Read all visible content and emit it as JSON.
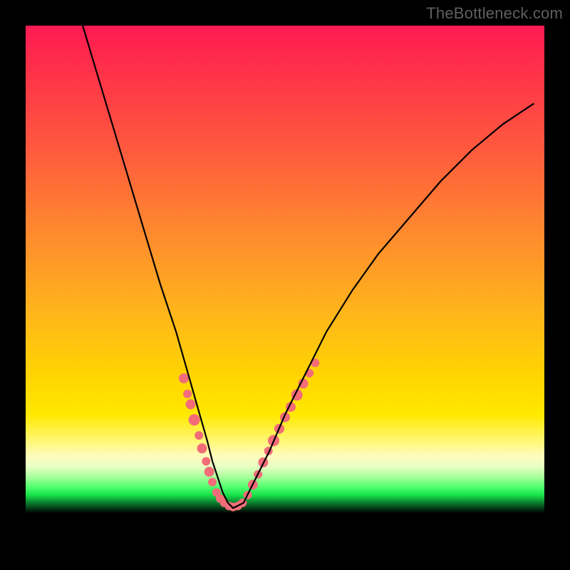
{
  "watermark": "TheBottleneck.com",
  "chart_data": {
    "type": "line",
    "title": "",
    "xlabel": "",
    "ylabel": "",
    "xlim": [
      0,
      100
    ],
    "ylim": [
      0,
      100
    ],
    "grid": false,
    "legend": false,
    "series": [
      {
        "name": "curve",
        "stroke": "#000000",
        "x": [
          11,
          14,
          17,
          20,
          23,
          26,
          29,
          31,
          33,
          35,
          36,
          37,
          38,
          39,
          40,
          42,
          44,
          47,
          50,
          54,
          58,
          63,
          68,
          74,
          80,
          86,
          92,
          98
        ],
        "y": [
          100,
          90,
          80,
          70,
          60,
          50,
          41,
          34,
          27,
          20,
          16,
          13,
          10,
          8,
          7,
          8,
          12,
          18,
          25,
          33,
          41,
          49,
          56,
          63,
          70,
          76,
          81,
          85
        ]
      }
    ],
    "markers": [
      {
        "name": "dots-left",
        "color": "#f26d78",
        "points": [
          {
            "x": 30.5,
            "y": 32,
            "r": 7
          },
          {
            "x": 31.2,
            "y": 29,
            "r": 6
          },
          {
            "x": 31.8,
            "y": 27,
            "r": 7
          },
          {
            "x": 32.5,
            "y": 24,
            "r": 8
          },
          {
            "x": 33.4,
            "y": 21,
            "r": 6
          },
          {
            "x": 34.0,
            "y": 18.5,
            "r": 7
          },
          {
            "x": 34.8,
            "y": 16,
            "r": 6
          },
          {
            "x": 35.4,
            "y": 14,
            "r": 7
          },
          {
            "x": 36.0,
            "y": 12,
            "r": 6
          },
          {
            "x": 36.8,
            "y": 10,
            "r": 6
          }
        ]
      },
      {
        "name": "dots-bottom",
        "color": "#f26d78",
        "points": [
          {
            "x": 37.5,
            "y": 8.8,
            "r": 6
          },
          {
            "x": 38.3,
            "y": 8.0,
            "r": 6
          },
          {
            "x": 39.2,
            "y": 7.4,
            "r": 6
          },
          {
            "x": 40.0,
            "y": 7.2,
            "r": 6
          },
          {
            "x": 40.9,
            "y": 7.4,
            "r": 6
          },
          {
            "x": 41.8,
            "y": 8.0,
            "r": 6
          }
        ]
      },
      {
        "name": "dots-right",
        "color": "#f26d78",
        "points": [
          {
            "x": 42.8,
            "y": 9.5,
            "r": 6
          },
          {
            "x": 43.8,
            "y": 11.5,
            "r": 7
          },
          {
            "x": 44.8,
            "y": 13.5,
            "r": 6
          },
          {
            "x": 45.8,
            "y": 15.8,
            "r": 7
          },
          {
            "x": 46.8,
            "y": 18,
            "r": 6
          },
          {
            "x": 47.8,
            "y": 20,
            "r": 8
          },
          {
            "x": 48.9,
            "y": 22.3,
            "r": 7
          },
          {
            "x": 50.0,
            "y": 24.5,
            "r": 7
          },
          {
            "x": 51.1,
            "y": 26.5,
            "r": 7
          },
          {
            "x": 52.3,
            "y": 28.8,
            "r": 8
          },
          {
            "x": 53.5,
            "y": 31,
            "r": 7
          },
          {
            "x": 54.7,
            "y": 33,
            "r": 6
          },
          {
            "x": 55.8,
            "y": 35,
            "r": 6
          }
        ]
      }
    ]
  }
}
